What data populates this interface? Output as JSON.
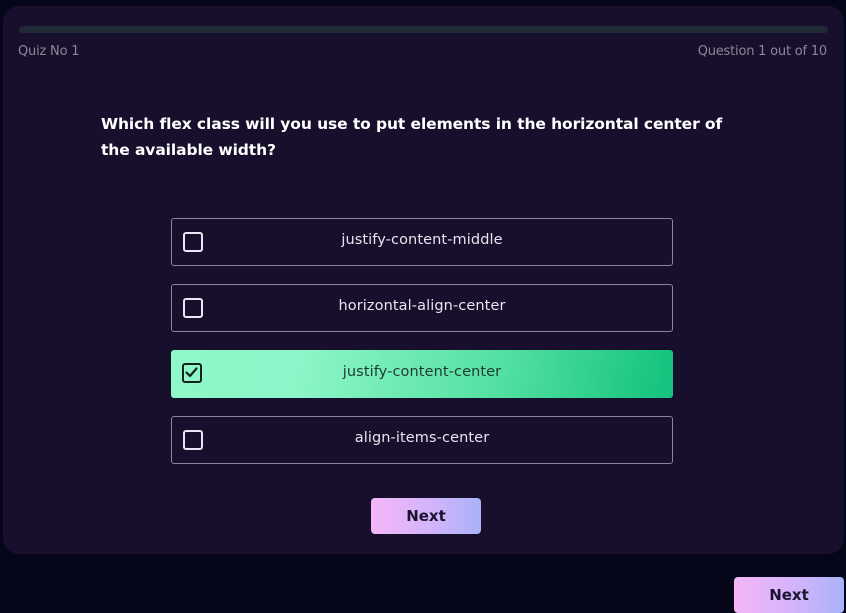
{
  "quiz": {
    "name": "Quiz No 1",
    "progress_text": "Question 1 out of 10",
    "progress_fraction": 0.0
  },
  "question": {
    "text": "Which flex class will you use to put elements in the horizontal center of the available width?"
  },
  "options": [
    {
      "label": "justify-content-middle",
      "checked": false
    },
    {
      "label": "horizontal-align-center",
      "checked": false
    },
    {
      "label": "justify-content-center",
      "checked": true
    },
    {
      "label": "align-items-center",
      "checked": false
    }
  ],
  "buttons": {
    "next_label": "Next",
    "next_label_secondary": "Next"
  },
  "colors": {
    "background": "#06061a",
    "card": "#170f2c",
    "selected_accent": "#12c27c",
    "button_gradient_start": "#f4b6f7",
    "button_gradient_end": "#a9b2f9"
  },
  "icons": {
    "checkbox_checked": "checkmark-icon",
    "checkbox_empty": "checkbox-icon"
  }
}
